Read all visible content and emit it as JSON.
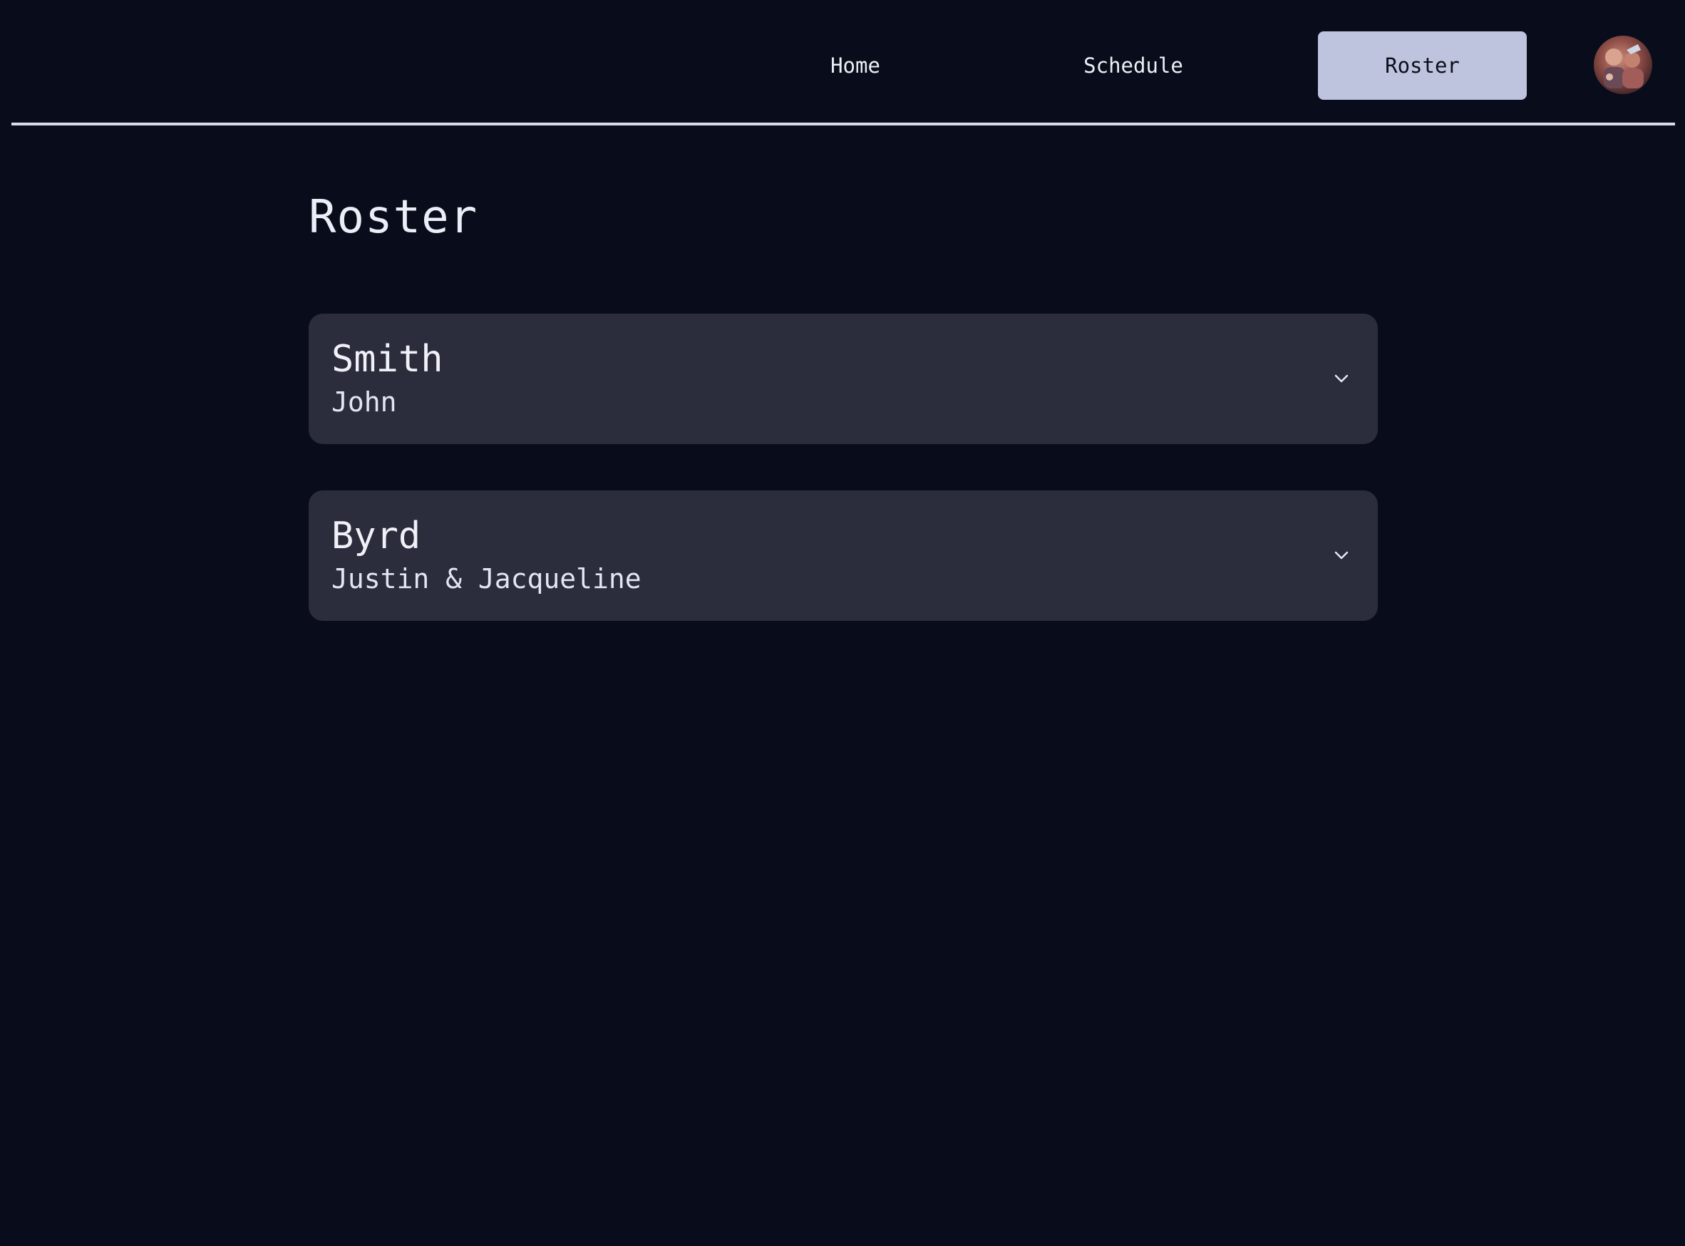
{
  "nav": {
    "items": [
      {
        "label": "Home",
        "active": false
      },
      {
        "label": "Schedule",
        "active": false
      },
      {
        "label": "Roster",
        "active": true
      }
    ],
    "avatar_icon": "user-avatar-photo"
  },
  "main": {
    "title": "Roster",
    "families": [
      {
        "last_name": "Smith",
        "first_names": "John",
        "expanded": false
      },
      {
        "last_name": "Byrd",
        "first_names": "Justin & Jacqueline",
        "expanded": false
      }
    ]
  },
  "colors": {
    "background": "#090c1a",
    "card": "#2b2d3c",
    "active_tab": "#bec4dd",
    "divider": "#d9dcec"
  }
}
